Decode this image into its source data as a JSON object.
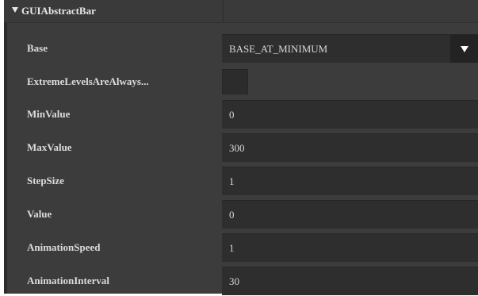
{
  "section": {
    "title": "GUIAbstractBar",
    "expand_icon": "triangle-down-icon"
  },
  "properties": [
    {
      "label": "Base",
      "value": "BASE_AT_MINIMUM",
      "type": "dropdown",
      "dropdown_icon": "triangle-down-icon"
    },
    {
      "label": "ExtremeLevelsAreAlways...",
      "value": "",
      "type": "checkbox",
      "checked": false
    },
    {
      "label": "MinValue",
      "value": "0",
      "type": "text"
    },
    {
      "label": "MaxValue",
      "value": "300",
      "type": "text"
    },
    {
      "label": "StepSize",
      "value": "1",
      "type": "text"
    },
    {
      "label": "Value",
      "value": "0",
      "type": "text"
    },
    {
      "label": "AnimationSpeed",
      "value": "1",
      "type": "text"
    },
    {
      "label": "AnimationInterval",
      "value": "30",
      "type": "text"
    }
  ],
  "colors": {
    "background": "#3c3c3c",
    "field": "#2e2e2e",
    "text": "#dcdcdc",
    "dropdown_button": "#232323"
  }
}
